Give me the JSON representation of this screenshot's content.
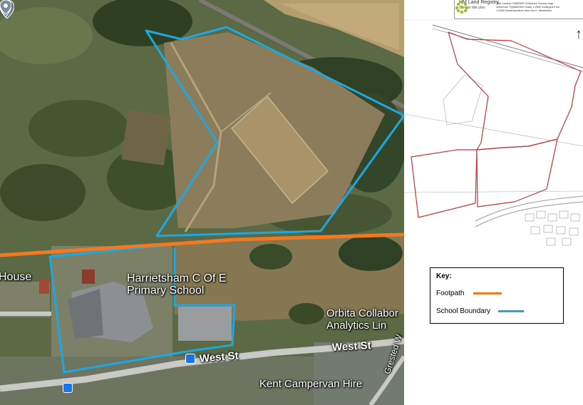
{
  "aerial_map": {
    "labels": {
      "school": "Harrietsham C Of E Primary School",
      "house": "House",
      "orbita": "Orbita Collabor Analytics Lin",
      "campervan": "Kent Campervan Hire",
      "west_st_1": "West St",
      "west_st_2": "West St",
      "road": "Grested W"
    },
    "colors": {
      "school_boundary": "#1ea7e1",
      "footpath": "#f07a22"
    }
  },
  "title_plan": {
    "registry": "HM Land Registry",
    "subtitle": "Current title plan",
    "meta": "Title number K869909 Ordnance Survey map reference TQ8652NW Scale 1:2500 enlarged from 1:2500 Administrative area Kent : Maidstone",
    "north": "↑",
    "boundary_color": "#c8323a"
  },
  "key": {
    "title": "Key:",
    "items": [
      {
        "label": "Footpath",
        "color": "#f07a22"
      },
      {
        "label": "School Boundary",
        "color": "#1ea7e1"
      }
    ]
  }
}
